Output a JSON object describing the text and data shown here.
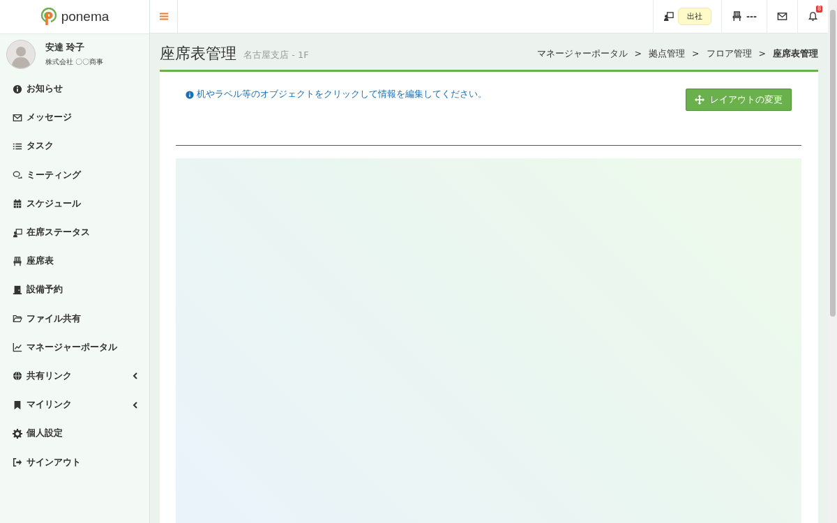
{
  "header": {
    "logo": "ponema",
    "attendance": {
      "label": "出社"
    },
    "seat": {
      "label": "---"
    },
    "notifications": {
      "badge": "8"
    }
  },
  "user": {
    "name": "安達 玲子",
    "company": "株式会社 〇〇商事"
  },
  "sidebar": {
    "items": [
      {
        "label": "お知らせ",
        "kind": "link"
      },
      {
        "label": "メッセージ",
        "kind": "link"
      },
      {
        "label": "タスク",
        "kind": "link"
      },
      {
        "label": "ミーティング",
        "kind": "link"
      },
      {
        "label": "スケジュール",
        "kind": "link"
      },
      {
        "label": "在席ステータス",
        "kind": "link"
      },
      {
        "label": "座席表",
        "kind": "link"
      },
      {
        "label": "設備予約",
        "kind": "link"
      },
      {
        "label": "ファイル共有",
        "kind": "link"
      },
      {
        "label": "マネージャーポータル",
        "kind": "link"
      },
      {
        "label": "共有リンク",
        "kind": "group"
      },
      {
        "label": "マイリンク",
        "kind": "group"
      },
      {
        "label": "個人設定",
        "kind": "link"
      },
      {
        "label": "サインアウト",
        "kind": "link"
      }
    ]
  },
  "page": {
    "title": "座席表管理",
    "subtitle": "名古屋支店 - 1F",
    "breadcrumb": [
      {
        "label": "マネージャーポータル",
        "current": false
      },
      {
        "label": "拠点管理",
        "current": false
      },
      {
        "label": "フロア管理",
        "current": false
      },
      {
        "label": "座席表管理",
        "current": true
      }
    ],
    "breadcrumb_separator": ">",
    "info": "机やラベル等のオブジェクトをクリックして情報を編集してください。",
    "layout_button": "レイアウトの変更"
  }
}
